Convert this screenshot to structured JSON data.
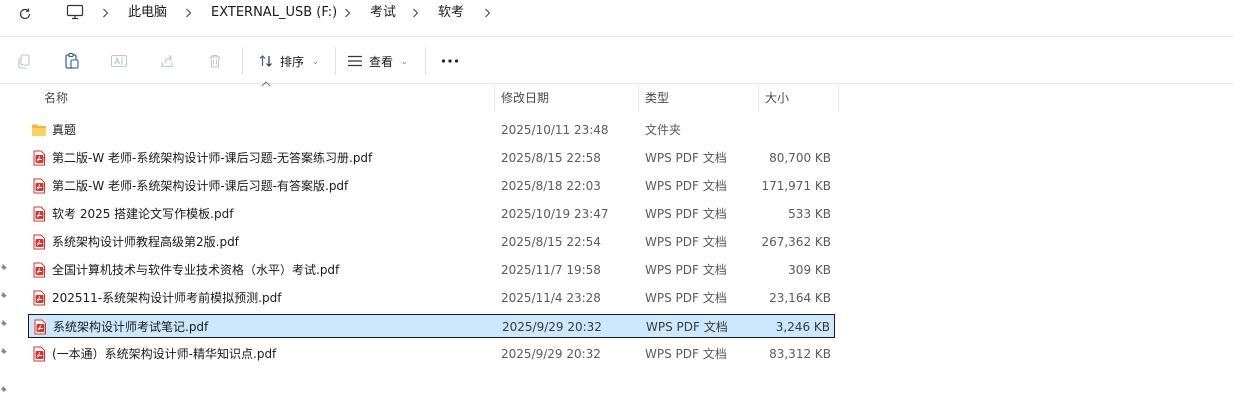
{
  "breadcrumb": {
    "items": [
      "此电脑",
      "EXTERNAL_USB (F:)",
      "考试",
      "软考"
    ]
  },
  "toolbar": {
    "sort_label": "排序",
    "view_label": "查看",
    "more_label": "···"
  },
  "columns": {
    "name": "名称",
    "date": "修改日期",
    "type": "类型",
    "size": "大小"
  },
  "files": [
    {
      "name": "真题",
      "date": "2025/10/11 23:48",
      "type": "文件夹",
      "size": "",
      "kind": "folder"
    },
    {
      "name": "第二版-W 老师-系统架构设计师-课后习题-无答案练习册.pdf",
      "date": "2025/8/15 22:58",
      "type": "WPS PDF 文档",
      "size": "80,700 KB",
      "kind": "pdf"
    },
    {
      "name": "第二版-W 老师-系统架构设计师-课后习题-有答案版.pdf",
      "date": "2025/8/18 22:03",
      "type": "WPS PDF 文档",
      "size": "171,971 KB",
      "kind": "pdf"
    },
    {
      "name": "软考 2025 搭建论文写作模板.pdf",
      "date": "2025/10/19 23:47",
      "type": "WPS PDF 文档",
      "size": "533 KB",
      "kind": "pdf"
    },
    {
      "name": "系统架构设计师教程高级第2版.pdf",
      "date": "2025/8/15 22:54",
      "type": "WPS PDF 文档",
      "size": "267,362 KB",
      "kind": "pdf"
    },
    {
      "name": "全国计算机技术与软件专业技术资格（水平）考试.pdf",
      "date": "2025/11/7 19:58",
      "type": "WPS PDF 文档",
      "size": "309 KB",
      "kind": "pdf"
    },
    {
      "name": "202511-系统架构设计师考前模拟预测.pdf",
      "date": "2025/11/4 23:28",
      "type": "WPS PDF 文档",
      "size": "23,164 KB",
      "kind": "pdf"
    },
    {
      "name": "系统架构设计师考试笔记.pdf",
      "date": "2025/9/29 20:32",
      "type": "WPS PDF 文档",
      "size": "3,246 KB",
      "kind": "pdf",
      "selected": true
    },
    {
      "name": "(一本通）系统架构设计师-精华知识点.pdf",
      "date": "2025/9/29 20:32",
      "type": "WPS PDF 文档",
      "size": "83,312 KB",
      "kind": "pdf"
    }
  ],
  "colors": {
    "selection_bg": "#cce8ff",
    "pdf_red": "#d9342b",
    "folder_yellow": "#f7c343"
  }
}
